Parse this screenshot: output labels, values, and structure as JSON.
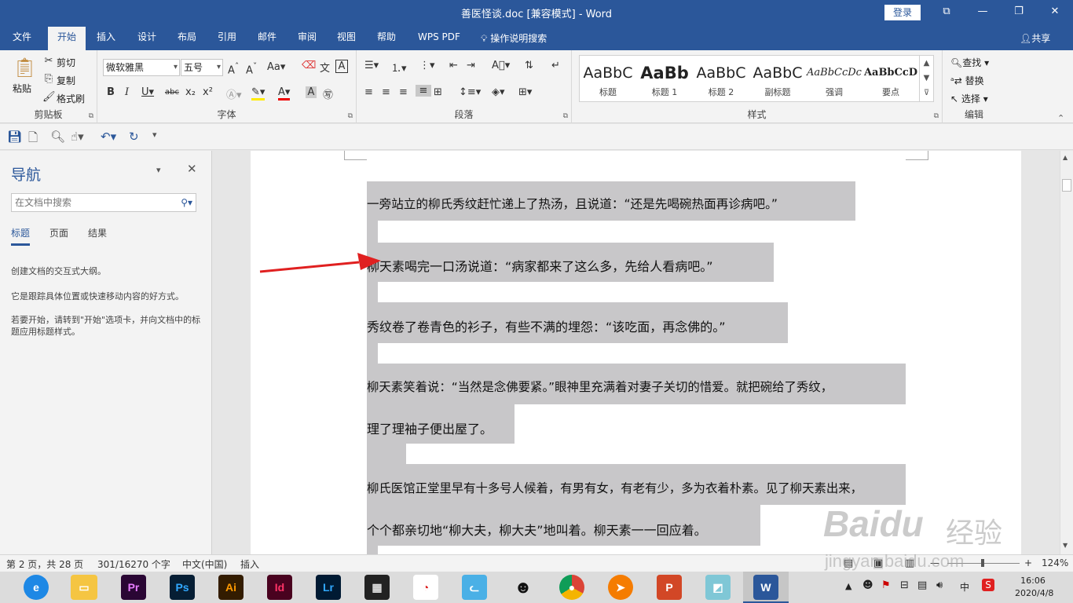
{
  "window": {
    "title": "善医怪谈.doc [兼容模式]  -  Word",
    "login": "登录",
    "minimize": "⧉",
    "restore": "❐",
    "close": "✕"
  },
  "tabs": [
    "文件",
    "开始",
    "插入",
    "设计",
    "布局",
    "引用",
    "邮件",
    "审阅",
    "视图",
    "帮助",
    "WPS PDF"
  ],
  "tell_me": "操作说明搜索",
  "share": "共享",
  "clipboard": {
    "paste": "粘贴",
    "cut": "剪切",
    "copy": "复制",
    "format_painter": "格式刷",
    "label": "剪贴板"
  },
  "font": {
    "name": "微软雅黑",
    "size": "五号",
    "label": "字体"
  },
  "paragraph": {
    "label": "段落"
  },
  "styles": {
    "label": "样式",
    "items": [
      {
        "sample": "AaBbC",
        "name": "标题"
      },
      {
        "sample": "AaBb",
        "name": "标题 1"
      },
      {
        "sample": "AaBbC",
        "name": "标题 2"
      },
      {
        "sample": "AaBbC",
        "name": "副标题"
      },
      {
        "sample": "AaBbCcDc",
        "name": "强调"
      },
      {
        "sample": "AaBbCcD",
        "name": "要点"
      }
    ]
  },
  "editing": {
    "find": "查找",
    "replace": "替换",
    "select": "选择",
    "label": "编辑"
  },
  "nav": {
    "title": "导航",
    "search_placeholder": "在文档中搜索",
    "tabs": [
      "标题",
      "页面",
      "结果"
    ],
    "text1": "创建文档的交互式大纲。",
    "text2": "它是跟踪具体位置或快速移动内容的好方式。",
    "text3": "若要开始，请转到\"开始\"选项卡，并向文档中的标题应用标题样式。"
  },
  "document": {
    "lines": [
      "一旁站立的柳氏秀纹赶忙递上了热汤，且说道：“还是先喝碗热面再诊病吧。”",
      "柳天素喝完一口汤说道：“病家都来了这么多，先给人看病吧。”",
      "秀纹卷了卷青色的衫子，有些不满的埋怨：“该吃面，再念佛的。”",
      "柳天素笑着说：“当然是念佛要紧。”眼神里充满着对妻子关切的惜爱。就把碗给了秀纹，",
      "理了理袖子便出屋了。",
      "柳氏医馆正堂里早有十多号人候着，有男有女，有老有少，多为衣着朴素。见了柳天素出来，",
      "个个都亲切地“柳大夫，柳大夫”地叫着。柳天素一一回应着。"
    ]
  },
  "status": {
    "page": "第 2 页，共 28 页",
    "words": "301/16270 个字",
    "language": "中文(中国)",
    "mode": "插入",
    "zoom": "124%"
  },
  "taskbar": {
    "apps": [
      "Pr",
      "Ps",
      "Ai",
      "Id",
      "Lr",
      "P",
      "W"
    ],
    "time": "16:06",
    "date": "2020/4/8",
    "ime": "中"
  },
  "watermark": {
    "brand": "Baidu",
    "cn": "经验",
    "url": "jingyan.baidu.com"
  },
  "colors": {
    "accent": "#2b579a",
    "highlight": "#c8c7c9",
    "arrow": "#e02020"
  }
}
